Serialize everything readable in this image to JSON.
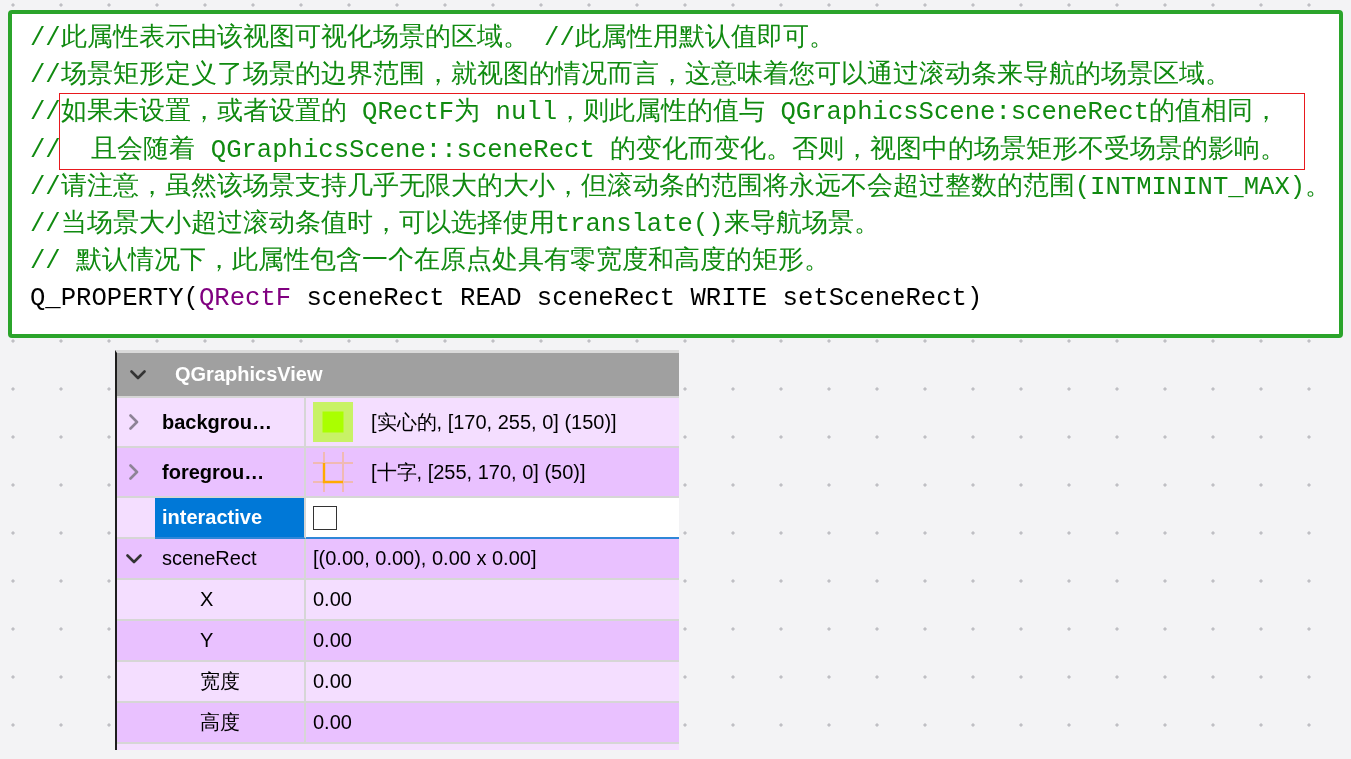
{
  "code": {
    "lines": [
      {
        "kind": "comment",
        "marker": "//",
        "text": "此属性表示由该视图可视化场景的区域。 //此属性用默认值即可。",
        "highlighted": false
      },
      {
        "kind": "comment",
        "marker": "//",
        "text": "场景矩形定义了场景的边界范围，就视图的情况而言，这意味着您可以通过滚动条来导航的场景区域。",
        "highlighted": false
      },
      {
        "kind": "comment",
        "marker": "//",
        "text": "如果未设置，或者设置的 QRectF为 null，则此属性的值与 QGraphicsScene:sceneRect的值相同，",
        "highlighted": true
      },
      {
        "kind": "comment",
        "marker": "//",
        "text": "  且会随着 QGraphicsScene::sceneRect 的变化而变化。否则，视图中的场景矩形不受场景的影响。",
        "highlighted": true
      },
      {
        "kind": "comment",
        "marker": "//",
        "text": "请注意，虽然该场景支持几乎无限大的大小，但滚动条的范围将永远不会超过整数的范围(INTMININT_MAX)。",
        "highlighted": false
      },
      {
        "kind": "comment",
        "marker": "//",
        "text": "当场景大小超过滚动条值时，可以选择使用translate()来导航场景。",
        "highlighted": false
      },
      {
        "kind": "comment",
        "marker": "//",
        "text": " 默认情况下，此属性包含一个在原点处具有零宽度和高度的矩形。",
        "highlighted": false
      },
      {
        "kind": "code",
        "spans": [
          {
            "text": "Q_PROPERTY(",
            "kind": "plain"
          },
          {
            "text": "QRectF",
            "kind": "type"
          },
          {
            "text": " sceneRect READ sceneRect WRITE setSceneRect)",
            "kind": "plain"
          }
        ],
        "highlighted": false
      }
    ]
  },
  "property_editor": {
    "group": {
      "title": "QGraphicsView",
      "expanded": true
    },
    "properties": [
      {
        "name": "backgrou…",
        "kind": "solid",
        "color": "#aaff00",
        "value": "[实心的, [170, 255, 0] (150)]",
        "modified": true,
        "expanded": false,
        "selected": false
      },
      {
        "name": "foregrou…",
        "kind": "cross",
        "color": "#ffaa00",
        "value": "[十字, [255, 170, 0] (50)]",
        "modified": true,
        "expanded": false,
        "selected": false
      },
      {
        "name": "interactive",
        "kind": "checkbox",
        "checked": false,
        "modified": true,
        "selected": true
      },
      {
        "name": "sceneRect",
        "kind": "text",
        "value": "[(0.00, 0.00), 0.00 x 0.00]",
        "modified": false,
        "expanded": true,
        "selected": false,
        "children": [
          {
            "name": "X",
            "kind": "text",
            "value": "0.00",
            "modified": false,
            "selected": false
          },
          {
            "name": "Y",
            "kind": "text",
            "value": "0.00",
            "modified": false,
            "selected": false
          },
          {
            "name": "宽度",
            "kind": "text",
            "value": "0.00",
            "modified": false,
            "selected": false
          },
          {
            "name": "高度",
            "kind": "text",
            "value": "0.00",
            "modified": false,
            "selected": false
          }
        ]
      }
    ]
  }
}
